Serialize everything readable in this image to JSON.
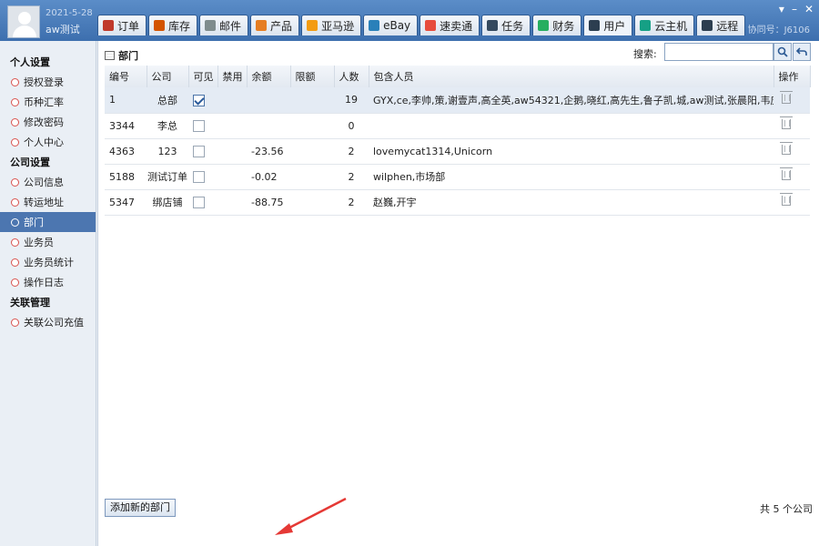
{
  "user": {
    "date": "2021-5-28",
    "name": "aw测试"
  },
  "account_label": "协同号：J6106",
  "window_controls": [
    "▾",
    "–",
    "✕"
  ],
  "tabs": [
    {
      "label": "订单",
      "icon": "order-icon",
      "color": "#c0392b"
    },
    {
      "label": "库存",
      "icon": "inventory-icon",
      "color": "#d35400"
    },
    {
      "label": "邮件",
      "icon": "mail-icon",
      "color": "#7f8c8d"
    },
    {
      "label": "产品",
      "icon": "product-icon",
      "color": "#e67e22"
    },
    {
      "label": "亚马逊",
      "icon": "amazon-icon",
      "color": "#f39c12"
    },
    {
      "label": "eBay",
      "icon": "ebay-icon",
      "color": "#2980b9"
    },
    {
      "label": "速卖通",
      "icon": "aliexpress-icon",
      "color": "#e74c3c"
    },
    {
      "label": "任务",
      "icon": "task-icon",
      "color": "#34495e"
    },
    {
      "label": "财务",
      "icon": "finance-icon",
      "color": "#27ae60"
    },
    {
      "label": "用户",
      "icon": "user-icon",
      "color": "#2c3e50",
      "active": true
    },
    {
      "label": "云主机",
      "icon": "cloud-host-icon",
      "color": "#16a085"
    },
    {
      "label": "远程",
      "icon": "remote-icon",
      "color": "#2c3e50"
    }
  ],
  "sidebar": {
    "groups": [
      {
        "title": "个人设置",
        "items": [
          {
            "label": "授权登录"
          },
          {
            "label": "币种汇率"
          },
          {
            "label": "修改密码"
          },
          {
            "label": "个人中心"
          }
        ]
      },
      {
        "title": "公司设置",
        "items": [
          {
            "label": "公司信息"
          },
          {
            "label": "转运地址"
          },
          {
            "label": "部门",
            "active": true
          },
          {
            "label": "业务员"
          },
          {
            "label": "业务员统计"
          },
          {
            "label": "操作日志"
          }
        ]
      },
      {
        "title": "关联管理",
        "items": [
          {
            "label": "关联公司充值"
          }
        ]
      }
    ]
  },
  "page": {
    "title": "部门",
    "search_label": "搜索:",
    "search_value": "",
    "columns": [
      "编号",
      "公司",
      "可见",
      "禁用",
      "余额",
      "限额",
      "人数",
      "包含人员",
      "操作"
    ],
    "rows": [
      {
        "id": "1",
        "company": "总部",
        "visible": true,
        "disabled": "",
        "balance": "",
        "limit": "",
        "count": "19",
        "members": "GYX,ce,李帅,策,谢壹声,高全英,aw54321,企鹅,晓红,高先生,鲁子凯,城,aw测试,张晨阳,韦应军,郦"
      },
      {
        "id": "3344",
        "company": "李总",
        "visible": false,
        "disabled": "",
        "balance": "",
        "limit": "",
        "count": "0",
        "members": ""
      },
      {
        "id": "4363",
        "company": "123",
        "visible": false,
        "disabled": "",
        "balance": "-23.56",
        "limit": "",
        "count": "2",
        "members": "lovemycat1314,Unicorn"
      },
      {
        "id": "5188",
        "company": "测试订单",
        "visible": false,
        "disabled": "",
        "balance": "-0.02",
        "limit": "",
        "count": "2",
        "members": "wilphen,市场部"
      },
      {
        "id": "5347",
        "company": "绑店铺",
        "visible": false,
        "disabled": "",
        "balance": "-88.75",
        "limit": "",
        "count": "2",
        "members": "赵巍,开宇"
      }
    ],
    "add_button": "添加新的部门",
    "total_text": "共 5 个公司"
  },
  "colors": {
    "titlebar": "#4a7cba",
    "active_side": "#4c76b0",
    "negative": "#2e7d32",
    "arrow": "#e53935"
  }
}
